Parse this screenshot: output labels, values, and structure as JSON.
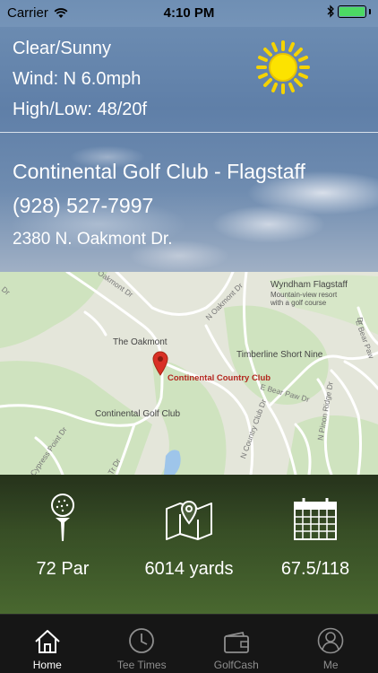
{
  "status_bar": {
    "carrier": "Carrier",
    "time": "4:10 PM",
    "battery_level_percent": 100
  },
  "weather": {
    "condition": "Clear/Sunny",
    "wind": "Wind: N 6.0mph",
    "high_low": "High/Low: 48/20f",
    "icon": "sun-icon"
  },
  "course": {
    "name": "Continental Golf Club - Flagstaff",
    "phone": "(928) 527-7997",
    "address": "2380 N. Oakmont Dr."
  },
  "map": {
    "labels": {
      "oakmont_dr_1": "Oakmont Dr",
      "oakmont_dr_2": "N Oakmont Dr",
      "wyndham": "Wyndham Flagstaff",
      "wyndham_sub1": "Mountain-view resort",
      "wyndham_sub2": "with a golf course",
      "the_oakmont": "The Oakmont",
      "timberline": "Timberline Short Nine",
      "continental_cc": "Continental Country Club",
      "continental_gc": "Continental Golf Club",
      "e_bear_paw": "E Bear Paw Dr",
      "n_country_club": "N Country Club Dr",
      "n_pinon_ridge": "N Pinon Ridge Dr",
      "e_bear_paw2": "E Bear Paw",
      "cypress_point": "Cypress Point Dr",
      "pinon_dr": "Pinon Dr",
      "tr_dr": "Tr Dr",
      "ak_dr": "ak Dr",
      "country_club": "N Country Club Dr",
      "dr_top": "Dr",
      "dr_right": "Dr"
    }
  },
  "stats": {
    "par": "72 Par",
    "yards": "6014 yards",
    "rating": "67.5/118"
  },
  "tabs": [
    {
      "label": "Home",
      "icon": "home-icon",
      "active": true
    },
    {
      "label": "Tee Times",
      "icon": "clock-icon",
      "active": false
    },
    {
      "label": "GolfCash",
      "icon": "wallet-icon",
      "active": false
    },
    {
      "label": "Me",
      "icon": "person-icon",
      "active": false
    }
  ],
  "colors": {
    "battery_fill": "#4cd964",
    "map_pin": "#d93025",
    "tab_active": "#ffffff",
    "tab_inactive": "#8e8e8e"
  }
}
